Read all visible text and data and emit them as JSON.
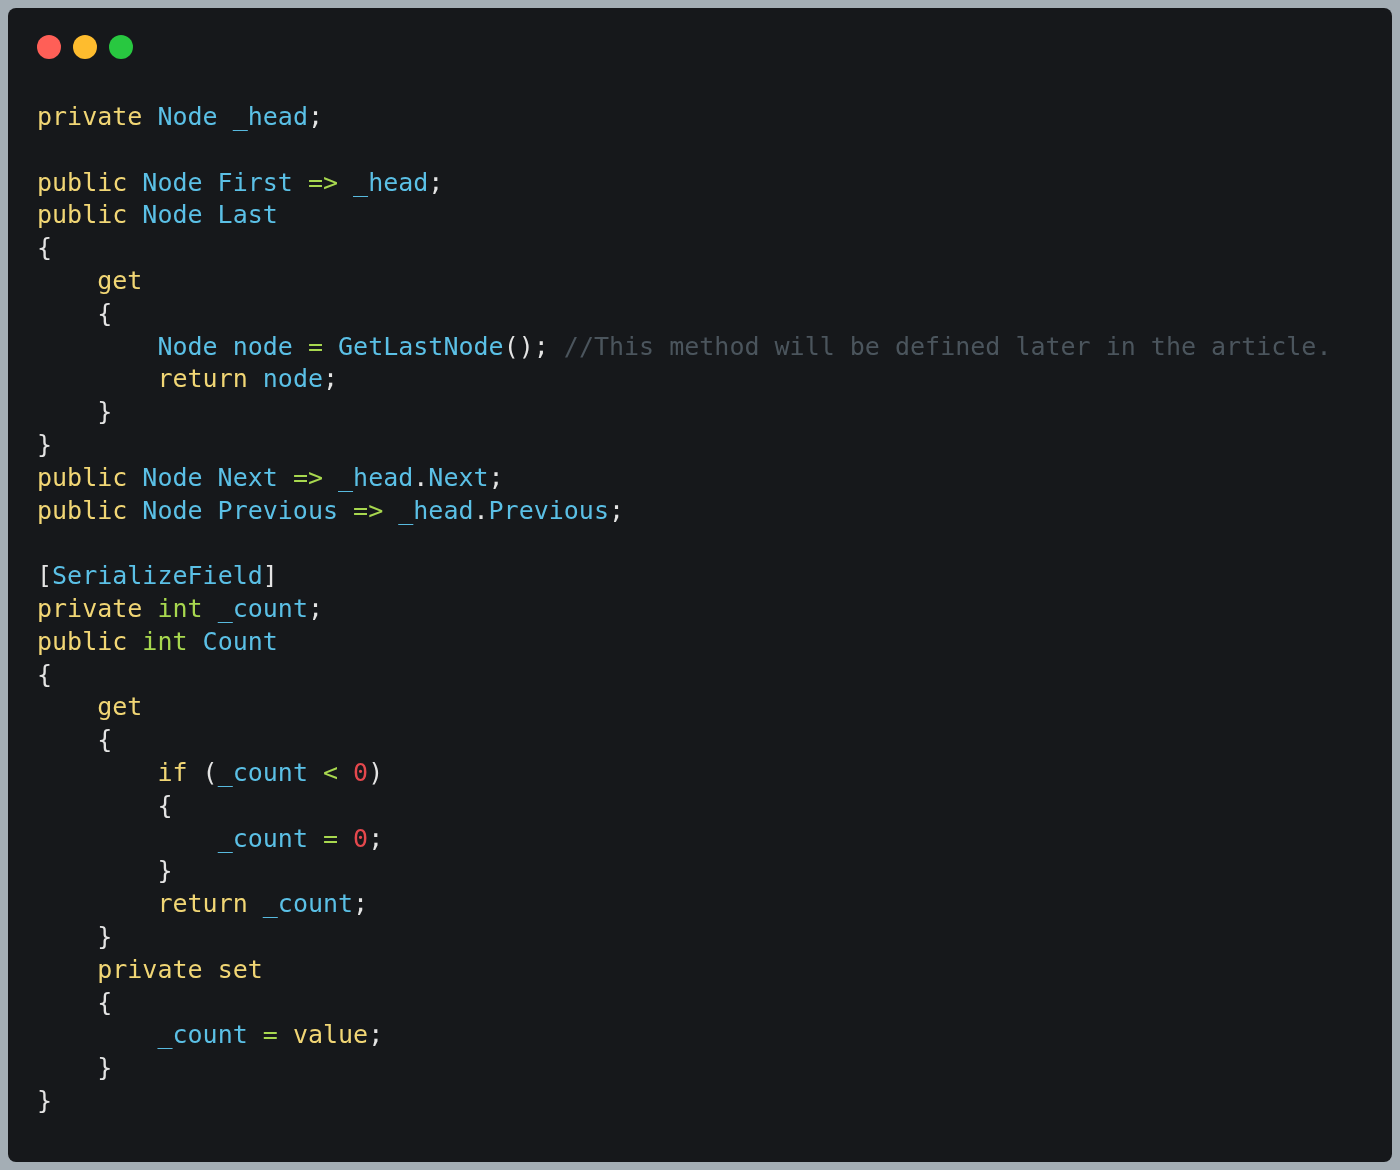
{
  "window": {
    "controls": [
      {
        "color": "#ff5f57"
      },
      {
        "color": "#febc2e"
      },
      {
        "color": "#28c840"
      }
    ]
  },
  "code_lines": [
    {
      "kind": "code",
      "tokens": [
        {
          "text": "private ",
          "kind": "keyword"
        },
        {
          "text": "Node _head",
          "kind": "name"
        },
        {
          "text": ";",
          "kind": "punct"
        }
      ]
    },
    {
      "kind": "blank"
    },
    {
      "kind": "code",
      "tokens": [
        {
          "text": "public ",
          "kind": "keyword"
        },
        {
          "text": "Node First ",
          "kind": "name"
        },
        {
          "text": "=> ",
          "kind": "operator"
        },
        {
          "text": "_head",
          "kind": "name"
        },
        {
          "text": ";",
          "kind": "punct"
        }
      ]
    },
    {
      "kind": "code",
      "tokens": [
        {
          "text": "public ",
          "kind": "keyword"
        },
        {
          "text": "Node Last",
          "kind": "name"
        }
      ]
    },
    {
      "kind": "code",
      "tokens": [
        {
          "text": "{",
          "kind": "punct"
        }
      ]
    },
    {
      "kind": "code",
      "tokens": [
        {
          "text": "    get",
          "kind": "keyword"
        }
      ]
    },
    {
      "kind": "code",
      "tokens": [
        {
          "text": "    {",
          "kind": "punct"
        }
      ]
    },
    {
      "kind": "code",
      "tokens": [
        {
          "text": "        Node node ",
          "kind": "name"
        },
        {
          "text": "= ",
          "kind": "operator"
        },
        {
          "text": "GetLastNode",
          "kind": "name"
        },
        {
          "text": "(); ",
          "kind": "punct"
        },
        {
          "text": "//This method will be defined later in the article.",
          "kind": "comment"
        }
      ]
    },
    {
      "kind": "code",
      "tokens": [
        {
          "text": "        return ",
          "kind": "keyword"
        },
        {
          "text": "node",
          "kind": "name"
        },
        {
          "text": ";",
          "kind": "punct"
        }
      ]
    },
    {
      "kind": "code",
      "tokens": [
        {
          "text": "    }",
          "kind": "punct"
        }
      ]
    },
    {
      "kind": "code",
      "tokens": [
        {
          "text": "}",
          "kind": "punct"
        }
      ]
    },
    {
      "kind": "code",
      "tokens": [
        {
          "text": "public ",
          "kind": "keyword"
        },
        {
          "text": "Node Next ",
          "kind": "name"
        },
        {
          "text": "=> ",
          "kind": "operator"
        },
        {
          "text": "_head",
          "kind": "name"
        },
        {
          "text": ".",
          "kind": "punct"
        },
        {
          "text": "Next",
          "kind": "name"
        },
        {
          "text": ";",
          "kind": "punct"
        }
      ]
    },
    {
      "kind": "code",
      "tokens": [
        {
          "text": "public ",
          "kind": "keyword"
        },
        {
          "text": "Node Previous ",
          "kind": "name"
        },
        {
          "text": "=> ",
          "kind": "operator"
        },
        {
          "text": "_head",
          "kind": "name"
        },
        {
          "text": ".",
          "kind": "punct"
        },
        {
          "text": "Previous",
          "kind": "name"
        },
        {
          "text": ";",
          "kind": "punct"
        }
      ]
    },
    {
      "kind": "blank"
    },
    {
      "kind": "code",
      "tokens": [
        {
          "text": "[",
          "kind": "punct"
        },
        {
          "text": "SerializeField",
          "kind": "name"
        },
        {
          "text": "]",
          "kind": "punct"
        }
      ]
    },
    {
      "kind": "code",
      "tokens": [
        {
          "text": "private ",
          "kind": "keyword"
        },
        {
          "text": "int ",
          "kind": "operator"
        },
        {
          "text": "_count",
          "kind": "name"
        },
        {
          "text": ";",
          "kind": "punct"
        }
      ]
    },
    {
      "kind": "code",
      "tokens": [
        {
          "text": "public ",
          "kind": "keyword"
        },
        {
          "text": "int ",
          "kind": "operator"
        },
        {
          "text": "Count",
          "kind": "name"
        }
      ]
    },
    {
      "kind": "code",
      "tokens": [
        {
          "text": "{",
          "kind": "punct"
        }
      ]
    },
    {
      "kind": "code",
      "tokens": [
        {
          "text": "    get",
          "kind": "keyword"
        }
      ]
    },
    {
      "kind": "code",
      "tokens": [
        {
          "text": "    {",
          "kind": "punct"
        }
      ]
    },
    {
      "kind": "code",
      "tokens": [
        {
          "text": "        if ",
          "kind": "keyword"
        },
        {
          "text": "(",
          "kind": "punct"
        },
        {
          "text": "_count ",
          "kind": "name"
        },
        {
          "text": "< ",
          "kind": "operator"
        },
        {
          "text": "0",
          "kind": "number"
        },
        {
          "text": ")",
          "kind": "punct"
        }
      ]
    },
    {
      "kind": "code",
      "tokens": [
        {
          "text": "        {",
          "kind": "punct"
        }
      ]
    },
    {
      "kind": "code",
      "tokens": [
        {
          "text": "            _count ",
          "kind": "name"
        },
        {
          "text": "= ",
          "kind": "operator"
        },
        {
          "text": "0",
          "kind": "number"
        },
        {
          "text": ";",
          "kind": "punct"
        }
      ]
    },
    {
      "kind": "code",
      "tokens": [
        {
          "text": "        }",
          "kind": "punct"
        }
      ]
    },
    {
      "kind": "code",
      "tokens": [
        {
          "text": "        return ",
          "kind": "keyword"
        },
        {
          "text": "_count",
          "kind": "name"
        },
        {
          "text": ";",
          "kind": "punct"
        }
      ]
    },
    {
      "kind": "code",
      "tokens": [
        {
          "text": "    }",
          "kind": "punct"
        }
      ]
    },
    {
      "kind": "code",
      "tokens": [
        {
          "text": "    private set",
          "kind": "keyword"
        }
      ]
    },
    {
      "kind": "code",
      "tokens": [
        {
          "text": "    {",
          "kind": "punct"
        }
      ]
    },
    {
      "kind": "code",
      "tokens": [
        {
          "text": "        _count ",
          "kind": "name"
        },
        {
          "text": "= ",
          "kind": "operator"
        },
        {
          "text": "value",
          "kind": "keyword"
        },
        {
          "text": ";",
          "kind": "punct"
        }
      ]
    },
    {
      "kind": "code",
      "tokens": [
        {
          "text": "    }",
          "kind": "punct"
        }
      ]
    },
    {
      "kind": "code",
      "tokens": [
        {
          "text": "}",
          "kind": "punct"
        }
      ]
    }
  ]
}
